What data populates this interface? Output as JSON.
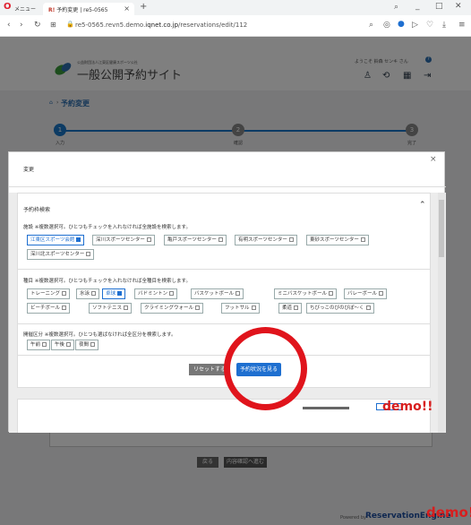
{
  "browser": {
    "menu_label": "メニュー",
    "tab_title": "予約変更 | re5-0565",
    "tab_icon_text": "R!",
    "new_tab": "+",
    "url_prefix": "re5-0565.revn5.demo.",
    "url_domain": "iqnet.co.jp",
    "url_path": "/reservations/edit/112"
  },
  "site": {
    "logo_small": "公益財団法人江東区健康スポーツ公社",
    "logo_title": "一般公開予約サイト",
    "welcome": "ようこそ 鈴森 センキ さん"
  },
  "page": {
    "breadcrumb_title": "予約変更",
    "steps": [
      {
        "number": "1",
        "label": "入力"
      },
      {
        "number": "2",
        "label": "確認"
      },
      {
        "number": "3",
        "label": "完了"
      }
    ],
    "back_button": "戻る",
    "confirm_button": "内容確認へ進む"
  },
  "modal": {
    "title": "変更",
    "close": "×",
    "panel_title": "予約枠検索",
    "facility": {
      "label": "施設",
      "note": "※複数選択可。ひとつもチェックを入れなければ全施設を検索します。",
      "options": [
        {
          "label": "江東区スポーツ会館",
          "checked": true
        },
        {
          "label": "深川スポーツセンター",
          "checked": false
        },
        {
          "label": "亀戸スポーツセンター",
          "checked": false
        },
        {
          "label": "有明スポーツセンター",
          "checked": false
        },
        {
          "label": "東砂スポーツセンター",
          "checked": false
        },
        {
          "label": "深川北スポーツセンター",
          "checked": false
        }
      ]
    },
    "sport": {
      "label": "種目",
      "note": "※複数選択可。ひとつもチェックを入れなければ全種目を検索します。",
      "options": [
        {
          "label": "トレーニング",
          "checked": false
        },
        {
          "label": "水泳",
          "checked": false
        },
        {
          "label": "卓球",
          "checked": true
        },
        {
          "label": "バドミントン",
          "checked": false
        },
        {
          "label": "バスケットボール",
          "checked": false
        },
        {
          "label": "ミニバスケットボール",
          "checked": false
        },
        {
          "label": "バレーボール",
          "checked": false
        },
        {
          "label": "ビーチボール",
          "checked": false
        },
        {
          "label": "ソフトテニス",
          "checked": false
        },
        {
          "label": "クライミングウォール",
          "checked": false
        },
        {
          "label": "フットサル",
          "checked": false
        },
        {
          "label": "柔道",
          "checked": false
        },
        {
          "label": "ちびっこのびのびぽ〜く",
          "checked": false
        }
      ]
    },
    "period": {
      "label": "開催区分",
      "note": "※複数選択可。ひとつも選ばなければ全区分を検索します。",
      "options": [
        {
          "label": "午前",
          "checked": false
        },
        {
          "label": "午後",
          "checked": false
        },
        {
          "label": "夜間",
          "checked": false
        }
      ]
    },
    "reset_button": "リセットする",
    "search_button": "予約状況を見る"
  },
  "footer": {
    "powered_by": "Powered by",
    "brand": "ReservationEngine"
  },
  "watermarks": [
    "demo!!",
    "demo!!"
  ],
  "colors": {
    "primary_blue": "#1e6fd0",
    "accent_red": "#d81e1e",
    "header_dark": "#2c3a4a",
    "step_blue": "#1976c9"
  }
}
